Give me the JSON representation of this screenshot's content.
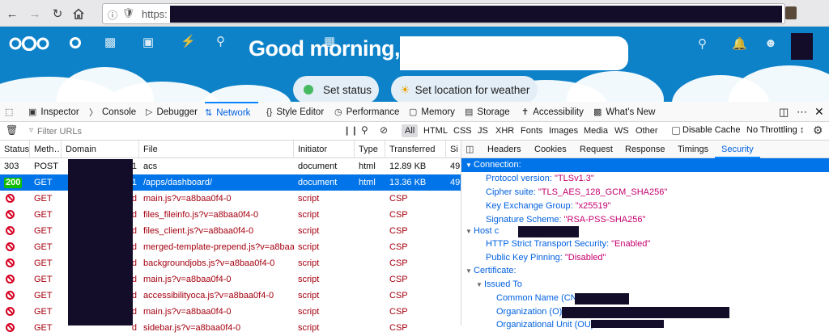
{
  "browser": {
    "url_prefix": "https:",
    "nav": {
      "back_icon": "back-arrow-icon",
      "forward_icon": "forward-arrow-icon",
      "reload_icon": "reload-icon",
      "home_icon": "home-icon"
    }
  },
  "nextcloud": {
    "greeting": "Good morning,",
    "set_status": "Set status",
    "set_location": "Set location for weather",
    "colors": {
      "header": "#0d82c9"
    }
  },
  "devtools": {
    "tabs": [
      {
        "label": "Inspector",
        "icon": "inspector-icon"
      },
      {
        "label": "Console",
        "icon": "console-icon"
      },
      {
        "label": "Debugger",
        "icon": "debugger-icon"
      },
      {
        "label": "Network",
        "icon": "network-icon"
      },
      {
        "label": "Style Editor",
        "icon": "style-editor-icon"
      },
      {
        "label": "Performance",
        "icon": "performance-icon"
      },
      {
        "label": "Memory",
        "icon": "memory-icon"
      },
      {
        "label": "Storage",
        "icon": "storage-icon"
      },
      {
        "label": "Accessibility",
        "icon": "accessibility-icon"
      },
      {
        "label": "What's New",
        "icon": "whats-new-icon"
      }
    ],
    "active_tab": "Network",
    "filter": {
      "placeholder": "Filter URLs",
      "types": [
        "All",
        "HTML",
        "CSS",
        "JS",
        "XHR",
        "Fonts",
        "Images",
        "Media",
        "WS",
        "Other"
      ],
      "selected_type": "All",
      "disable_cache_label": "Disable Cache",
      "throttling_label": "No Throttling ↕"
    },
    "columns": [
      "Status",
      "Meth…",
      "Domain",
      "File",
      "Initiator",
      "Type",
      "Transferred",
      "Si"
    ],
    "rows": [
      {
        "status": "303",
        "method": "POST",
        "file": "acs",
        "initiator": "document",
        "type": "html",
        "transferred": "12.89 KB",
        "size": "49",
        "domain_suffix": "01"
      },
      {
        "status": "200",
        "method": "GET",
        "file": "/apps/dashboard/",
        "initiator": "document",
        "type": "html",
        "transferred": "13.36 KB",
        "size": "49",
        "domain_suffix": "01"
      },
      {
        "status": "blocked",
        "method": "GET",
        "file": "main.js?v=a8baa0f4-0",
        "initiator": "script",
        "type": "",
        "transferred": "CSP",
        "size": "",
        "domain_suffix": "d"
      },
      {
        "status": "blocked",
        "method": "GET",
        "file": "files_fileinfo.js?v=a8baa0f4-0",
        "initiator": "script",
        "type": "",
        "transferred": "CSP",
        "size": "",
        "domain_suffix": "d"
      },
      {
        "status": "blocked",
        "method": "GET",
        "file": "files_client.js?v=a8baa0f4-0",
        "initiator": "script",
        "type": "",
        "transferred": "CSP",
        "size": "",
        "domain_suffix": "d"
      },
      {
        "status": "blocked",
        "method": "GET",
        "file": "merged-template-prepend.js?v=a8baa0…",
        "initiator": "script",
        "type": "",
        "transferred": "CSP",
        "size": "",
        "domain_suffix": "d"
      },
      {
        "status": "blocked",
        "method": "GET",
        "file": "backgroundjobs.js?v=a8baa0f4-0",
        "initiator": "script",
        "type": "",
        "transferred": "CSP",
        "size": "",
        "domain_suffix": "d"
      },
      {
        "status": "blocked",
        "method": "GET",
        "file": "main.js?v=a8baa0f4-0",
        "initiator": "script",
        "type": "",
        "transferred": "CSP",
        "size": "",
        "domain_suffix": "d"
      },
      {
        "status": "blocked",
        "method": "GET",
        "file": "accessibilityoca.js?v=a8baa0f4-0",
        "initiator": "script",
        "type": "",
        "transferred": "CSP",
        "size": "",
        "domain_suffix": "d"
      },
      {
        "status": "blocked",
        "method": "GET",
        "file": "main.js?v=a8baa0f4-0",
        "initiator": "script",
        "type": "",
        "transferred": "CSP",
        "size": "",
        "domain_suffix": "d"
      },
      {
        "status": "blocked",
        "method": "GET",
        "file": "sidebar.js?v=a8baa0f4-0",
        "initiator": "script",
        "type": "",
        "transferred": "CSP",
        "size": "",
        "domain_suffix": "d"
      }
    ],
    "side_tabs": [
      "Headers",
      "Cookies",
      "Request",
      "Response",
      "Timings",
      "Security"
    ],
    "side_active": "Security",
    "security": {
      "connection_label": "Connection:",
      "protocol_key": "Protocol version:",
      "protocol_val": "\"TLSv1.3\"",
      "cipher_key": "Cipher suite:",
      "cipher_val": "\"TLS_AES_128_GCM_SHA256\"",
      "kex_key": "Key Exchange Group:",
      "kex_val": "\"x25519\"",
      "sig_key": "Signature Scheme:",
      "sig_val": "\"RSA-PSS-SHA256\"",
      "host_label": "Host",
      "hsts_key": "HTTP Strict Transport Security:",
      "hsts_val": "\"Enabled\"",
      "pkp_key": "Public Key Pinning:",
      "pkp_val": "\"Disabled\"",
      "cert_label": "Certificate:",
      "issued_to_label": "Issued To",
      "cn_key": "Common Name (CN):",
      "cn_val": "\"",
      "org_key": "Organization (O):",
      "org_val": "\"",
      "ou_key": "Organizational Unit (OU):",
      "ou_val": "\""
    }
  }
}
